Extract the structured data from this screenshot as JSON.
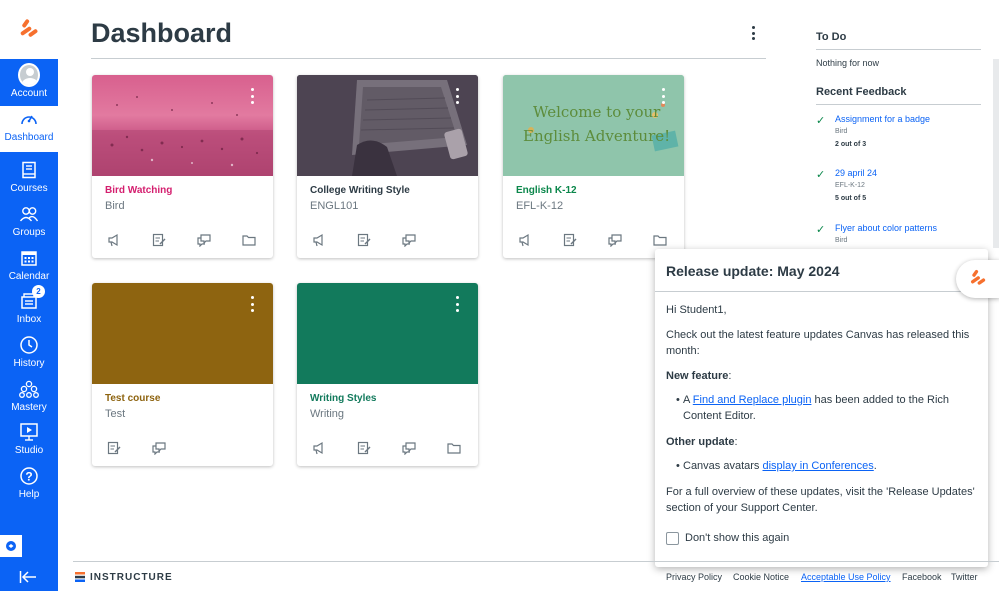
{
  "nav": {
    "account": "Account",
    "dashboard": "Dashboard",
    "courses": "Courses",
    "groups": "Groups",
    "calendar": "Calendar",
    "inbox": "Inbox",
    "inbox_badge": "2",
    "history": "History",
    "mastery": "Mastery",
    "studio": "Studio",
    "help": "Help"
  },
  "header": {
    "title": "Dashboard"
  },
  "cards": [
    {
      "name": "Bird Watching",
      "code": "Bird",
      "color": "#d41e6e",
      "hero": "pink-photo"
    },
    {
      "name": "College Writing Style",
      "code": "ENGL101",
      "color": "#2d3b45",
      "hero": "laptop-photo"
    },
    {
      "name": "English K-12",
      "code": "EFL-K-12",
      "color": "#0b874b",
      "hero": "welcome-image",
      "hero_text_line1": "Welcome to your",
      "hero_text_line2": "English Adventure!"
    },
    {
      "name": "Test course",
      "code": "Test",
      "color": "#8e6410",
      "hero": "solid"
    },
    {
      "name": "Writing Styles",
      "code": "Writing",
      "color": "#127a5c",
      "hero": "solid"
    }
  ],
  "sidebar": {
    "todo_title": "To Do",
    "todo_empty": "Nothing for now",
    "feedback_title": "Recent Feedback",
    "feedback": [
      {
        "title": "Assignment for a badge",
        "course": "Bird",
        "score": "2 out of 3"
      },
      {
        "title": "29 april 24",
        "course": "EFL-K-12",
        "score": "5 out of 5"
      },
      {
        "title": "Flyer about color patterns",
        "course": "Bird"
      }
    ]
  },
  "popup": {
    "title": "Release update: May 2024",
    "greeting": "Hi Student1,",
    "intro": "Check out the latest feature updates Canvas has released this month:",
    "new_feature_heading": "New feature",
    "new_feature_pre": "A ",
    "new_feature_link": "Find and Replace plugin",
    "new_feature_post": " has been added to the Rich Content Editor.",
    "other_heading": "Other update",
    "other_pre": "Canvas avatars ",
    "other_link": "display in Conferences",
    "other_post": ".",
    "overview": "For a full overview of these updates, visit the 'Release Updates' section of your Support Center.",
    "checkbox_label": "Don't show this again"
  },
  "footer": {
    "brand": "INSTRUCTURE",
    "links": [
      "Privacy Policy",
      "Cookie Notice",
      "Acceptable Use Policy",
      "Facebook",
      "Twitter"
    ]
  },
  "colors": {
    "nav_blue": "#0b63f5",
    "canvas_orange": "#f6702e"
  }
}
